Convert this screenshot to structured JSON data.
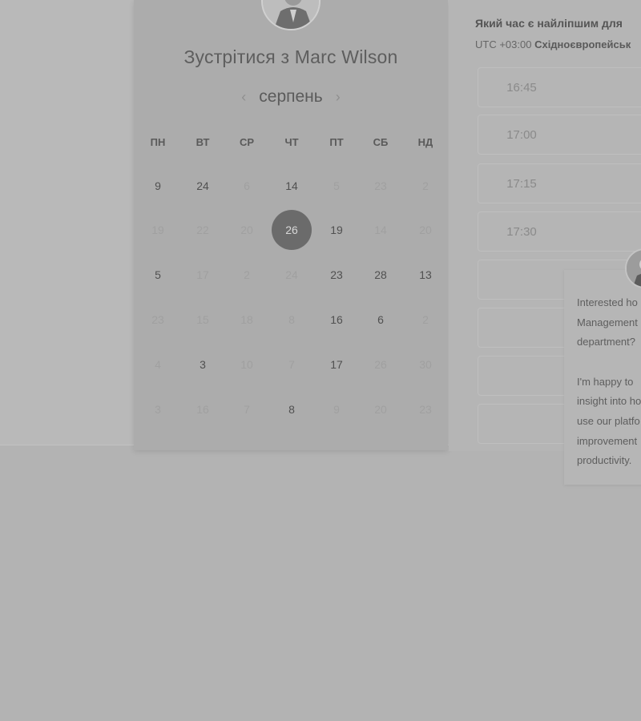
{
  "scheduler": {
    "title": "Зустрітися з Marc Wilson",
    "month": "серпень",
    "prev_icon": "chevron-left-icon",
    "next_icon": "chevron-right-icon",
    "weekdays": [
      "ПН",
      "ВТ",
      "СР",
      "ЧТ",
      "ПТ",
      "СБ",
      "НД"
    ],
    "weeks": [
      [
        {
          "d": "9",
          "a": true
        },
        {
          "d": "24",
          "a": true
        },
        {
          "d": "6",
          "a": false
        },
        {
          "d": "14",
          "a": true
        },
        {
          "d": "5",
          "a": false
        },
        {
          "d": "23",
          "a": false
        },
        {
          "d": "2",
          "a": false
        }
      ],
      [
        {
          "d": "19",
          "a": false
        },
        {
          "d": "22",
          "a": false
        },
        {
          "d": "20",
          "a": false
        },
        {
          "d": "26",
          "a": true,
          "selected": true
        },
        {
          "d": "19",
          "a": true
        },
        {
          "d": "14",
          "a": false
        },
        {
          "d": "20",
          "a": false
        }
      ],
      [
        {
          "d": "5",
          "a": true
        },
        {
          "d": "17",
          "a": false
        },
        {
          "d": "2",
          "a": false
        },
        {
          "d": "24",
          "a": false
        },
        {
          "d": "23",
          "a": true
        },
        {
          "d": "28",
          "a": true
        },
        {
          "d": "13",
          "a": true
        }
      ],
      [
        {
          "d": "23",
          "a": false
        },
        {
          "d": "15",
          "a": false
        },
        {
          "d": "18",
          "a": false
        },
        {
          "d": "8",
          "a": false
        },
        {
          "d": "16",
          "a": true
        },
        {
          "d": "6",
          "a": true
        },
        {
          "d": "2",
          "a": false
        }
      ],
      [
        {
          "d": "4",
          "a": false
        },
        {
          "d": "3",
          "a": true
        },
        {
          "d": "10",
          "a": false
        },
        {
          "d": "7",
          "a": false
        },
        {
          "d": "17",
          "a": true
        },
        {
          "d": "26",
          "a": false
        },
        {
          "d": "30",
          "a": false
        }
      ],
      [
        {
          "d": "3",
          "a": false
        },
        {
          "d": "16",
          "a": false
        },
        {
          "d": "7",
          "a": false
        },
        {
          "d": "8",
          "a": true
        },
        {
          "d": "9",
          "a": false
        },
        {
          "d": "20",
          "a": false
        },
        {
          "d": "23",
          "a": false
        }
      ]
    ]
  },
  "times": {
    "question": "Який час є найліпшим для",
    "tz_offset": "UTC +03:00",
    "tz_name": "Східноєвропейськ",
    "slots": [
      "16:45",
      "17:00",
      "17:15",
      "17:30",
      "",
      "",
      "",
      ""
    ]
  },
  "chat": {
    "lines": [
      "Interested ho",
      "Management",
      "department?",
      "",
      "I'm happy to",
      "insight into ho",
      "use our platfo",
      "improvement",
      "productivity."
    ]
  },
  "colors": {
    "selected_day": "#6b6b6b",
    "overlay_bg": "#b3b3b3"
  }
}
